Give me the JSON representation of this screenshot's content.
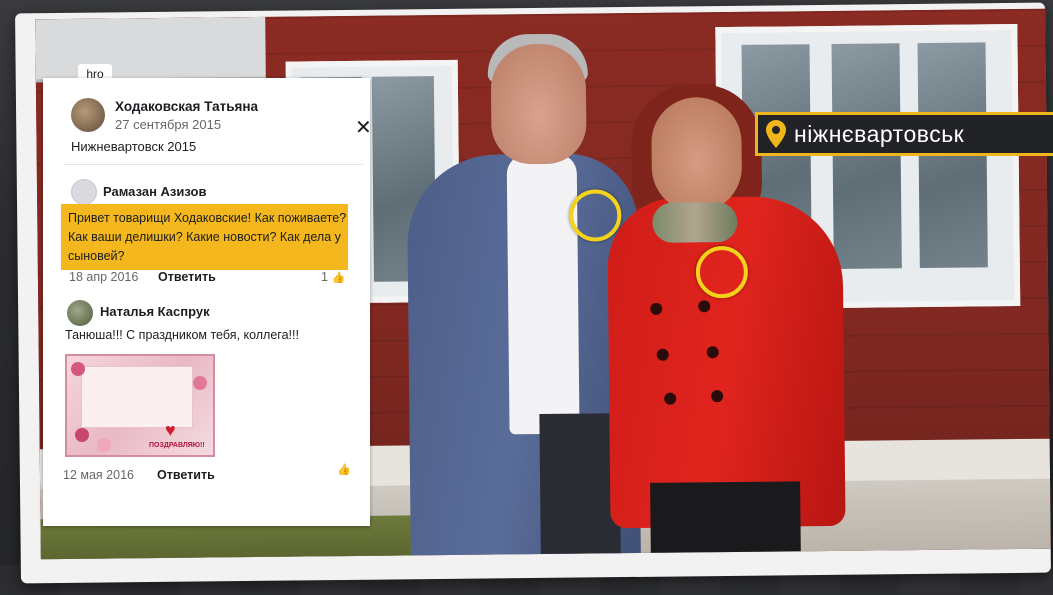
{
  "post": {
    "tab_label": "hro",
    "author": "Ходаковская Татьяна",
    "date": "27 сентября 2015",
    "text": "Нижневартовск 2015",
    "close_symbol": "✕"
  },
  "comments": [
    {
      "author": "Рамазан Азизов",
      "text": "Привет товарищи Ходаковские! Как поживаете? Как ваши делишки? Какие новости? Как дела у сыновей?",
      "date": "18 апр 2016",
      "reply_label": "Ответить",
      "likes": "1",
      "highlighted": true
    },
    {
      "author": "Наталья Каспрук",
      "text": "Танюша!!! С праздником тебя, коллега!!!",
      "date": "12 мая 2016",
      "reply_label": "Ответить",
      "attachment_banner": "ПОЗДРАВЛЯЮ!!"
    }
  ],
  "location": {
    "name": "ніжнєвартовськ",
    "icon": "map-pin-icon"
  },
  "colors": {
    "highlight": "#f4b81e",
    "badge_border": "#f1b51c",
    "ring": "#f2d21b"
  }
}
